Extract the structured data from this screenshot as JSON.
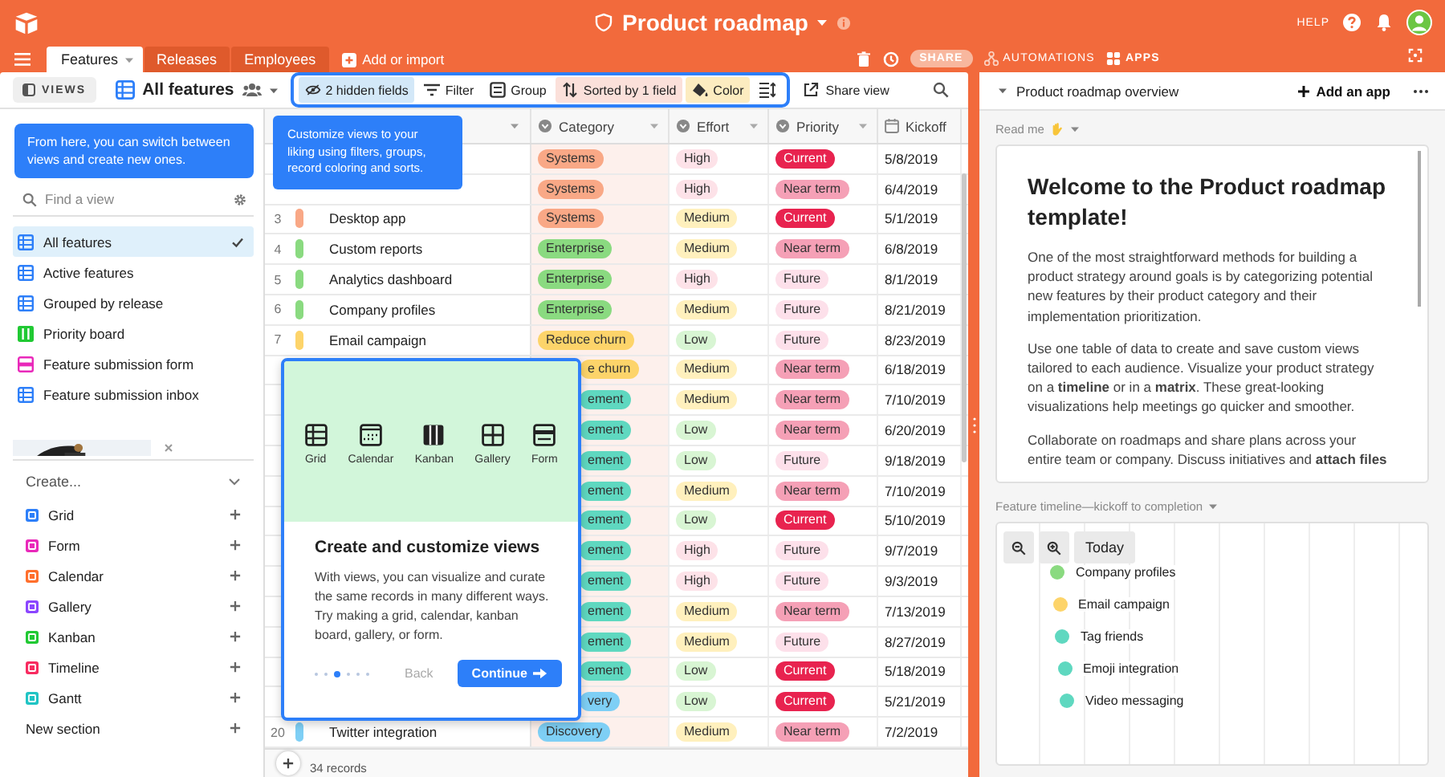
{
  "app_bar": {
    "title": "Product roadmap",
    "help": "HELP"
  },
  "tabs": [
    {
      "label": "Features",
      "selected": true
    },
    {
      "label": "Releases",
      "selected": false
    },
    {
      "label": "Employees",
      "selected": false
    }
  ],
  "add_table": "Add or import",
  "header_actions": {
    "share": "SHARE",
    "automations": "AUTOMATIONS",
    "apps": "APPS"
  },
  "toolbar": {
    "views_button": "VIEWS",
    "view_name": "All features",
    "share_view": "Share view",
    "tools": [
      {
        "kind": "hidden",
        "label": "2 hidden fields",
        "color": "#d3e8f8"
      },
      {
        "kind": "filter",
        "label": "Filter"
      },
      {
        "kind": "group",
        "label": "Group"
      },
      {
        "kind": "sort",
        "label": "Sorted by 1 field",
        "color": "#fbe0da"
      },
      {
        "kind": "color",
        "label": "Color",
        "color": "#fcecc0"
      },
      {
        "kind": "row-height"
      }
    ]
  },
  "views_tip": "From here, you can switch between views and create new ones.",
  "view_search": {
    "placeholder": "Find a view"
  },
  "views": [
    {
      "label": "All features",
      "kind": "grid",
      "selected": true
    },
    {
      "label": "Active features",
      "kind": "grid",
      "selected": false
    },
    {
      "label": "Grouped by release",
      "kind": "grid",
      "selected": false
    },
    {
      "label": "Priority board",
      "kind": "kanban",
      "selected": false
    },
    {
      "label": "Feature submission form",
      "kind": "form",
      "selected": false
    },
    {
      "label": "Feature submission inbox",
      "kind": "grid",
      "selected": false
    }
  ],
  "create": {
    "label": "Create...",
    "new_section": "New section",
    "items": [
      {
        "label": "Grid",
        "color": "#2d7ff9"
      },
      {
        "label": "Form",
        "color": "#e929ba"
      },
      {
        "label": "Calendar",
        "color": "#ff6f2c"
      },
      {
        "label": "Gallery",
        "color": "#8b46ff"
      },
      {
        "label": "Kanban",
        "color": "#20c933"
      },
      {
        "label": "Timeline",
        "color": "#f82b60"
      },
      {
        "label": "Gantt",
        "color": "#20c4c4"
      }
    ]
  },
  "grid": {
    "footer": "34 records",
    "columns": [
      {
        "label": "Category",
        "kind": "select"
      },
      {
        "label": "Effort",
        "kind": "select"
      },
      {
        "label": "Priority",
        "kind": "select"
      },
      {
        "label": "Kickoff",
        "kind": "date"
      }
    ],
    "rows": [
      {
        "category": {
          "text": "Systems",
          "color": "#f9a886"
        },
        "effort": {
          "text": "High",
          "color": "#fde2e8"
        },
        "priority": {
          "text": "Current",
          "color": "#e8234f"
        },
        "kickoff": "5/8/2019"
      },
      {
        "category": {
          "text": "Systems",
          "color": "#f9a886"
        },
        "effort": {
          "text": "High",
          "color": "#fde2e8"
        },
        "priority": {
          "text": "Near term",
          "color": "#f5a0b6"
        },
        "kickoff": "6/4/2019"
      },
      {
        "number": "3",
        "color": "#f9a886",
        "name": "Desktop app",
        "category": {
          "text": "Systems",
          "color": "#f9a886"
        },
        "effort": {
          "text": "Medium",
          "color": "#fff0bd"
        },
        "priority": {
          "text": "Current",
          "color": "#e8234f"
        },
        "kickoff": "5/1/2019"
      },
      {
        "number": "4",
        "color": "#8ada80",
        "name": "Custom reports",
        "category": {
          "text": "Enterprise",
          "color": "#8ada80"
        },
        "effort": {
          "text": "Medium",
          "color": "#fff0bd"
        },
        "priority": {
          "text": "Near term",
          "color": "#f5a0b6"
        },
        "kickoff": "6/8/2019"
      },
      {
        "number": "5",
        "color": "#8ada80",
        "name": "Analytics dashboard",
        "category": {
          "text": "Enterprise",
          "color": "#8ada80"
        },
        "effort": {
          "text": "High",
          "color": "#fde2e8"
        },
        "priority": {
          "text": "Future",
          "color": "#fde0ea"
        },
        "kickoff": "8/1/2019"
      },
      {
        "number": "6",
        "color": "#8ada80",
        "name": "Company profiles",
        "category": {
          "text": "Enterprise",
          "color": "#8ada80"
        },
        "effort": {
          "text": "Medium",
          "color": "#fff0bd"
        },
        "priority": {
          "text": "Future",
          "color": "#fde0ea"
        },
        "kickoff": "8/21/2019"
      },
      {
        "number": "7",
        "color": "#fdd46a",
        "name": "Email campaign",
        "category": {
          "text": "Reduce churn",
          "color": "#fdd46a"
        },
        "effort": {
          "text": "Low",
          "color": "#d8f5d3"
        },
        "priority": {
          "text": "Future",
          "color": "#fde0ea"
        },
        "kickoff": "8/23/2019"
      },
      {
        "category": {
          "text": "e churn",
          "color": "#fdd46a"
        },
        "effort": {
          "text": "Medium",
          "color": "#fff0bd"
        },
        "priority": {
          "text": "Near term",
          "color": "#f5a0b6"
        },
        "kickoff": "6/18/2019"
      },
      {
        "category": {
          "text": "ement",
          "color": "#5fd8c0"
        },
        "effort": {
          "text": "Medium",
          "color": "#fff0bd"
        },
        "priority": {
          "text": "Near term",
          "color": "#f5a0b6"
        },
        "kickoff": "7/10/2019"
      },
      {
        "category": {
          "text": "ement",
          "color": "#5fd8c0"
        },
        "effort": {
          "text": "Low",
          "color": "#d8f5d3"
        },
        "priority": {
          "text": "Near term",
          "color": "#f5a0b6"
        },
        "kickoff": "6/20/2019"
      },
      {
        "category": {
          "text": "ement",
          "color": "#5fd8c0"
        },
        "effort": {
          "text": "Low",
          "color": "#d8f5d3"
        },
        "priority": {
          "text": "Future",
          "color": "#fde0ea"
        },
        "kickoff": "9/18/2019"
      },
      {
        "category": {
          "text": "ement",
          "color": "#5fd8c0"
        },
        "effort": {
          "text": "Medium",
          "color": "#fff0bd"
        },
        "priority": {
          "text": "Near term",
          "color": "#f5a0b6"
        },
        "kickoff": "7/10/2019"
      },
      {
        "category": {
          "text": "ement",
          "color": "#5fd8c0"
        },
        "effort": {
          "text": "Low",
          "color": "#d8f5d3"
        },
        "priority": {
          "text": "Current",
          "color": "#e8234f"
        },
        "kickoff": "5/10/2019"
      },
      {
        "category": {
          "text": "ement",
          "color": "#5fd8c0"
        },
        "effort": {
          "text": "High",
          "color": "#fde2e8"
        },
        "priority": {
          "text": "Future",
          "color": "#fde0ea"
        },
        "kickoff": "9/7/2019"
      },
      {
        "category": {
          "text": "ement",
          "color": "#5fd8c0"
        },
        "effort": {
          "text": "High",
          "color": "#fde2e8"
        },
        "priority": {
          "text": "Future",
          "color": "#fde0ea"
        },
        "kickoff": "9/3/2019"
      },
      {
        "category": {
          "text": "ement",
          "color": "#5fd8c0"
        },
        "effort": {
          "text": "Medium",
          "color": "#fff0bd"
        },
        "priority": {
          "text": "Near term",
          "color": "#f5a0b6"
        },
        "kickoff": "7/13/2019"
      },
      {
        "category": {
          "text": "ement",
          "color": "#5fd8c0"
        },
        "effort": {
          "text": "Medium",
          "color": "#fff0bd"
        },
        "priority": {
          "text": "Future",
          "color": "#fde0ea"
        },
        "kickoff": "8/27/2019"
      },
      {
        "category": {
          "text": "ement",
          "color": "#5fd8c0"
        },
        "effort": {
          "text": "Low",
          "color": "#d8f5d3"
        },
        "priority": {
          "text": "Current",
          "color": "#e8234f"
        },
        "kickoff": "5/18/2019"
      },
      {
        "category": {
          "text": "very",
          "color": "#7ecff5"
        },
        "effort": {
          "text": "Low",
          "color": "#d8f5d3"
        },
        "priority": {
          "text": "Current",
          "color": "#e8234f"
        },
        "kickoff": "5/21/2019"
      },
      {
        "number": "20",
        "color": "#7ecff5",
        "name": "Twitter integration",
        "category": {
          "text": "Discovery",
          "color": "#7ecff5"
        },
        "effort": {
          "text": "Medium",
          "color": "#fff0bd"
        },
        "priority": {
          "text": "Near term",
          "color": "#f5a0b6"
        },
        "kickoff": "7/2/2019"
      }
    ]
  },
  "grid_tip": "Customize views to your liking using filters, groups, record coloring and sorts.",
  "tour": {
    "options": [
      {
        "label": "Grid",
        "kind": "grid"
      },
      {
        "label": "Calendar",
        "kind": "calendar"
      },
      {
        "label": "Kanban",
        "kind": "kanban"
      },
      {
        "label": "Gallery",
        "kind": "gallery"
      },
      {
        "label": "Form",
        "kind": "form"
      }
    ],
    "title": "Create and customize views",
    "body": "With views, you can visualize and curate the same records in many different ways. Try making a grid, calendar, kanban board, gallery, or form.",
    "steps": [
      {
        "selected": false
      },
      {
        "selected": false
      },
      {
        "selected": true
      },
      {
        "selected": false
      },
      {
        "selected": false
      },
      {
        "selected": false
      }
    ],
    "back": "Back",
    "continue": "Continue"
  },
  "panel": {
    "title": "Product roadmap overview",
    "add_app": "Add an app",
    "readme_label": "Read me",
    "readme": {
      "heading": "Welcome to the Product roadmap template!",
      "paragraphs": [
        "One of the most straightforward methods for building a product strategy around goals is by categorizing potential new features by their product category and their implementation prioritization.",
        "Use one table of data to create and save custom views tailored to each audience. Visualize your product strategy on a **timeline** or in a **matrix**. These great-looking visualizations help meetings go quicker and smoother.",
        "Collaborate on roadmaps and share plans across your entire team or company. Discuss initiatives and **attach files**"
      ]
    },
    "timeline_label": "Feature timeline—kickoff to completion",
    "timeline": {
      "today": "Today",
      "items": [
        {
          "label": "Company profiles",
          "color": "#8ada80"
        },
        {
          "label": "Email campaign",
          "color": "#fdd46a"
        },
        {
          "label": "Tag friends",
          "color": "#5fd8c0"
        },
        {
          "label": "Emoji integration",
          "color": "#5fd8c0"
        },
        {
          "label": "Video messaging",
          "color": "#5fd8c0"
        }
      ]
    }
  }
}
